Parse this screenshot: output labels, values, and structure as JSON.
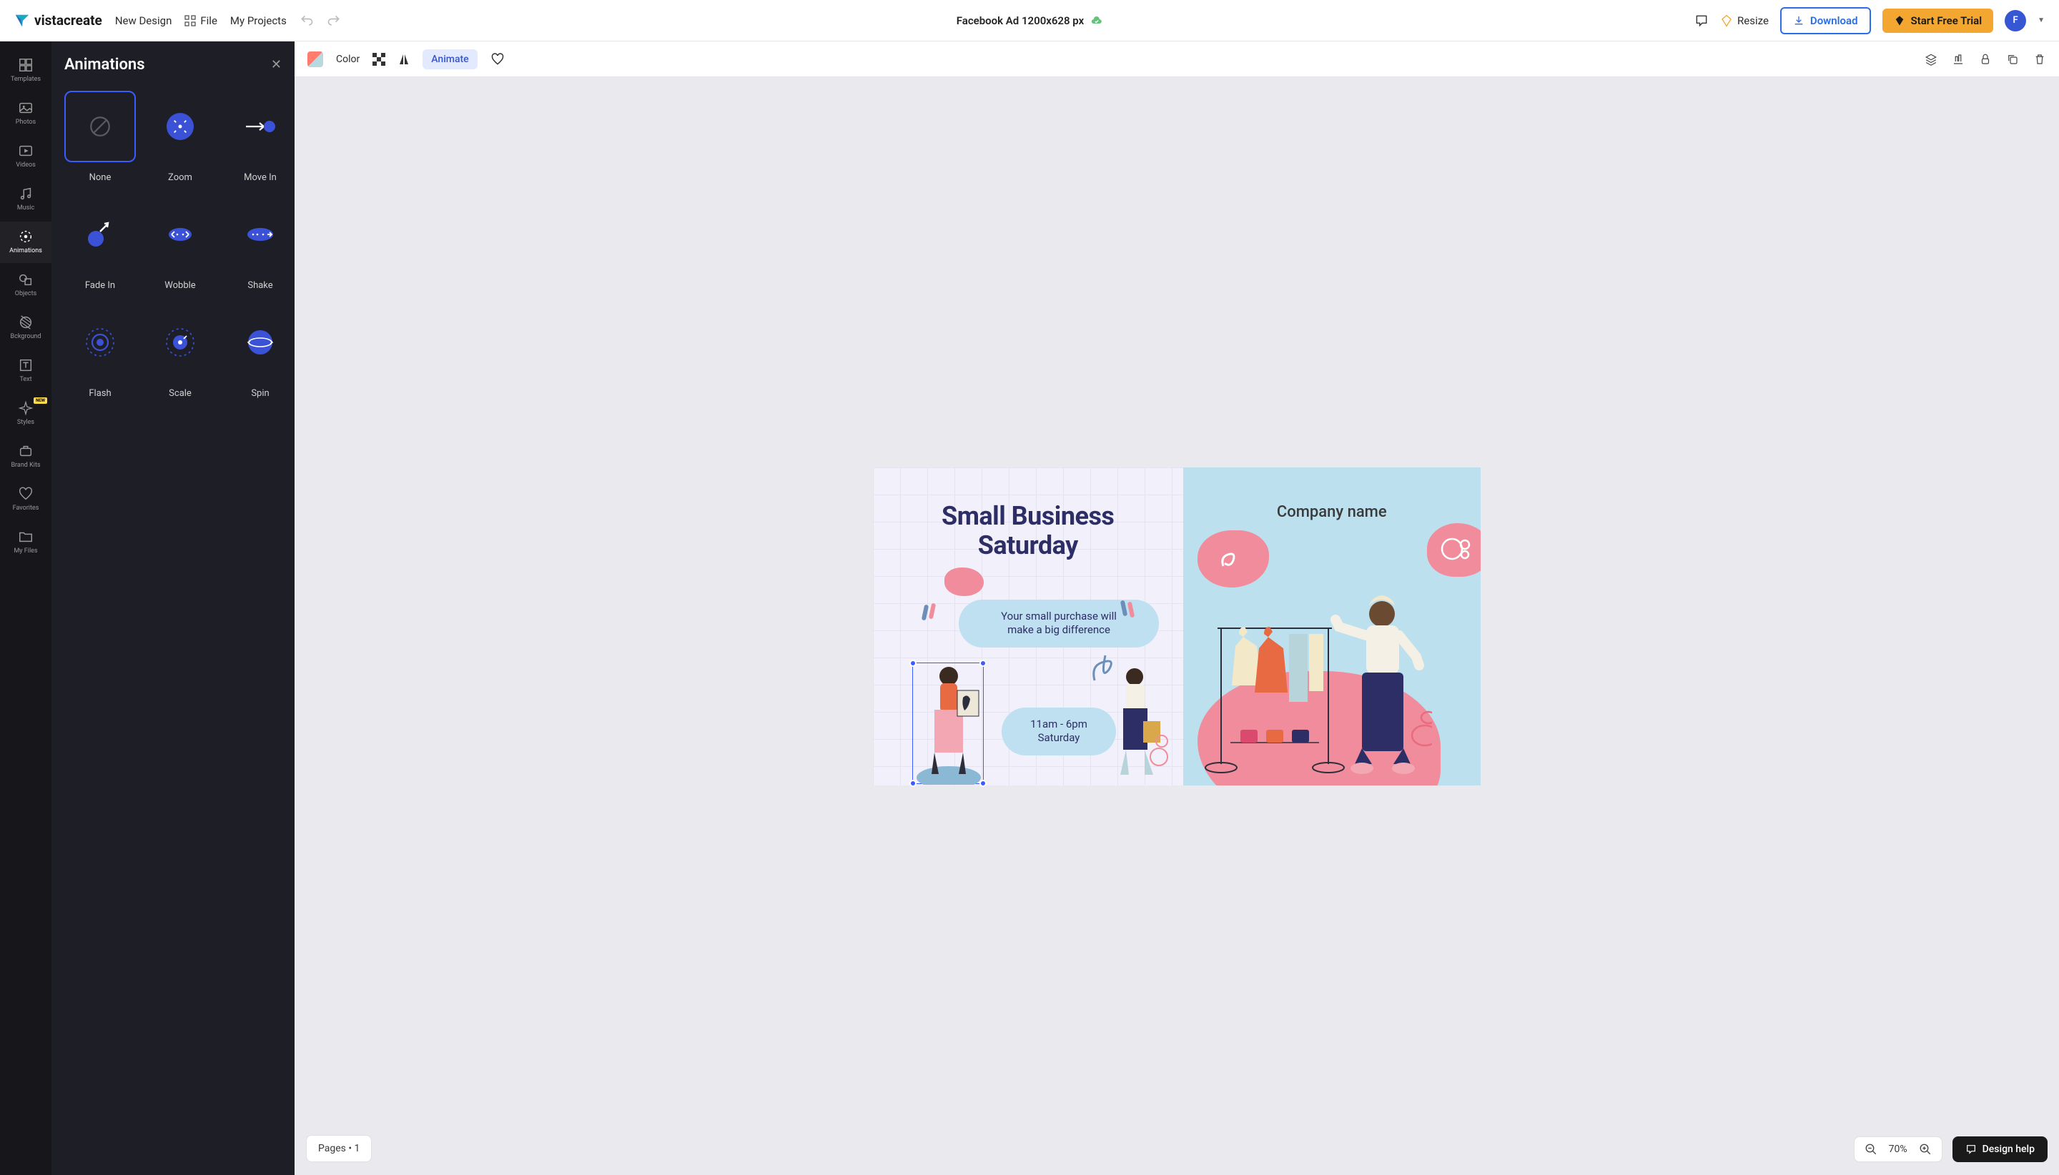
{
  "brand": "vistacreate",
  "header": {
    "new_design": "New Design",
    "file": "File",
    "my_projects": "My Projects",
    "doc_title": "Facebook Ad 1200x628 px",
    "resize": "Resize",
    "download": "Download",
    "start_trial": "Start Free Trial",
    "avatar_initial": "F"
  },
  "rail": [
    {
      "key": "templates",
      "label": "Templates"
    },
    {
      "key": "photos",
      "label": "Photos"
    },
    {
      "key": "videos",
      "label": "Videos"
    },
    {
      "key": "music",
      "label": "Music"
    },
    {
      "key": "animations",
      "label": "Animations",
      "active": true
    },
    {
      "key": "objects",
      "label": "Objects"
    },
    {
      "key": "background",
      "label": "Bckground"
    },
    {
      "key": "text",
      "label": "Text"
    },
    {
      "key": "styles",
      "label": "Styles",
      "badge": "NEW"
    },
    {
      "key": "brandkits",
      "label": "Brand Kits"
    },
    {
      "key": "favorites",
      "label": "Favorites"
    },
    {
      "key": "myfiles",
      "label": "My Files"
    }
  ],
  "sidepanel": {
    "title": "Animations",
    "items": [
      {
        "key": "none",
        "label": "None",
        "selected": true
      },
      {
        "key": "zoom",
        "label": "Zoom"
      },
      {
        "key": "movein",
        "label": "Move In"
      },
      {
        "key": "fadein",
        "label": "Fade In"
      },
      {
        "key": "wobble",
        "label": "Wobble"
      },
      {
        "key": "shake",
        "label": "Shake"
      },
      {
        "key": "flash",
        "label": "Flash"
      },
      {
        "key": "scale",
        "label": "Scale"
      },
      {
        "key": "spin",
        "label": "Spin"
      }
    ]
  },
  "toolbar": {
    "color": "Color",
    "animate": "Animate"
  },
  "canvas": {
    "headline_line1": "Small Business",
    "headline_line2": "Saturday",
    "bubble1_line1": "Your small purchase will",
    "bubble1_line2": "make a big difference",
    "bubble2_line1": "11am - 6pm",
    "bubble2_line2": "Saturday",
    "company_name": "Company name"
  },
  "bottom": {
    "pages_label": "Pages • 1",
    "zoom": "70%",
    "design_help": "Design help"
  },
  "colors": {
    "accent": "#3756d4",
    "brand_orange": "#f4a730",
    "dark_panel": "#1e1e26",
    "canvas_blue": "#bde0ef",
    "canvas_pink": "#f08c9b",
    "canvas_navy": "#2d2e66"
  }
}
